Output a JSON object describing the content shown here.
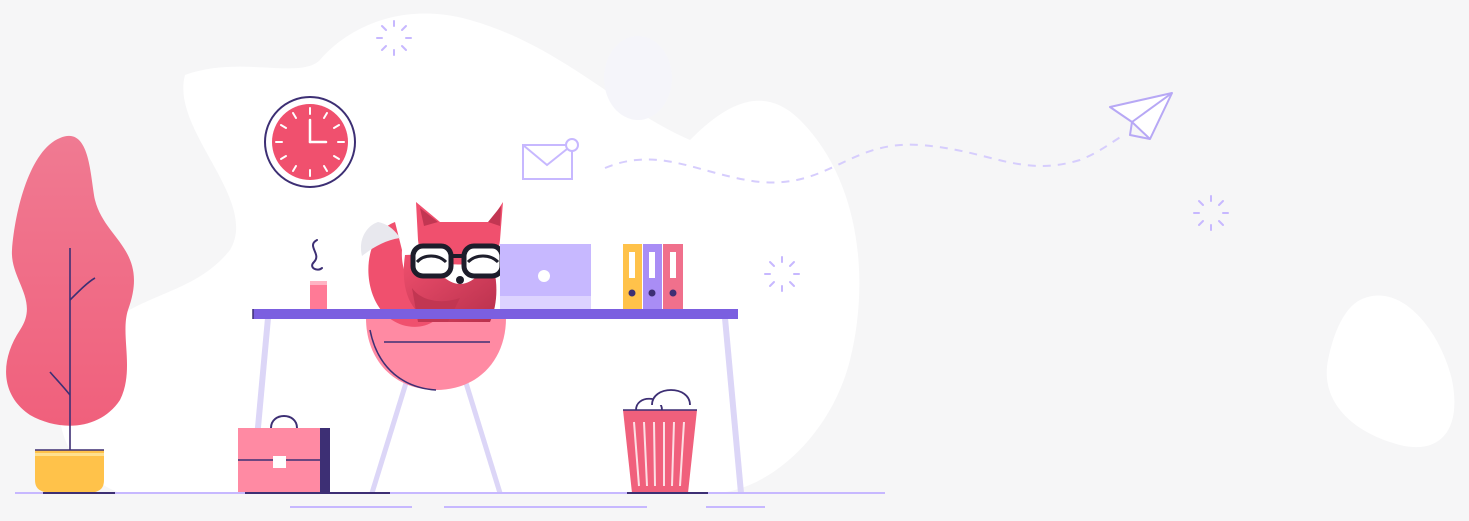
{
  "illustration": {
    "subject": "fox-with-glasses-working-at-desk",
    "icons": [
      "wall-clock-icon",
      "envelope-icon",
      "paper-plane-icon",
      "laptop-icon",
      "binder-icon",
      "coffee-cup-icon",
      "briefcase-icon",
      "trash-bin-icon",
      "potted-plant-icon",
      "sparkle-icon"
    ]
  },
  "colors": {
    "background": "#f6f6f7",
    "blob": "#ffffff",
    "pink": "#f0506e",
    "light_pink": "#ff8aa3",
    "purple": "#7b5fe0",
    "lavender": "#c7b8ff",
    "navy": "#3d2f74",
    "yellow": "#ffc24a"
  }
}
